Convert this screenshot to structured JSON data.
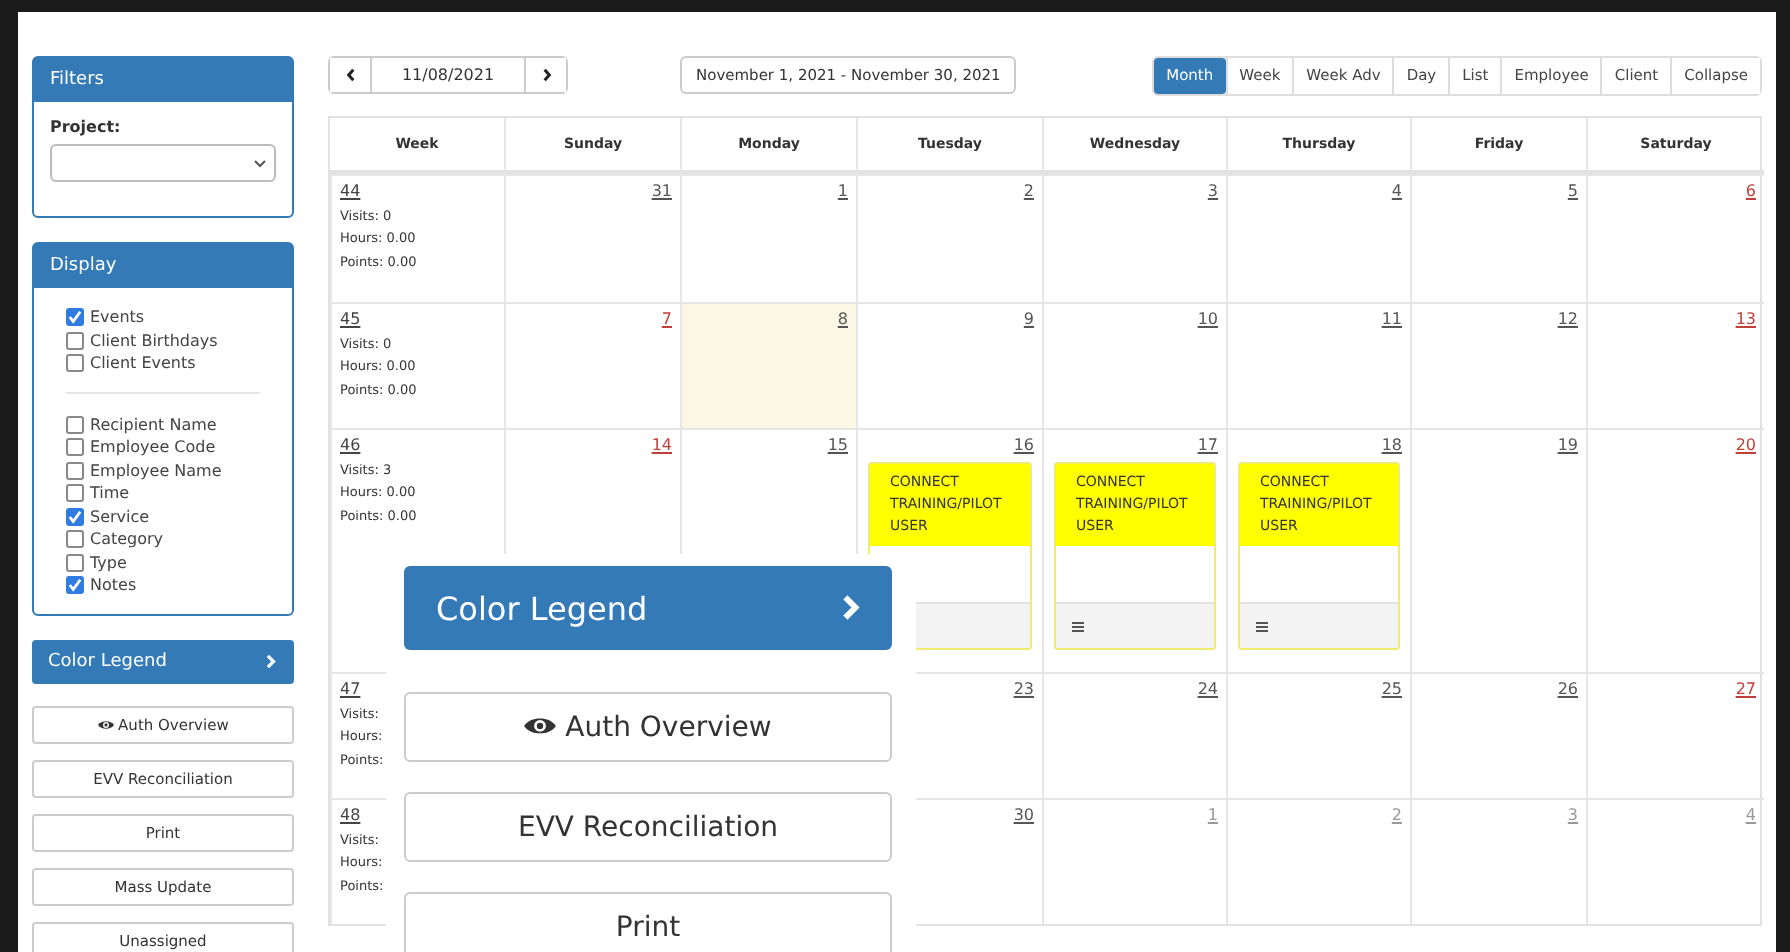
{
  "filters": {
    "title": "Filters",
    "project_label": "Project:"
  },
  "display": {
    "title": "Display",
    "groups": [
      [
        {
          "label": "Events",
          "checked": true
        },
        {
          "label": "Client Birthdays",
          "checked": false
        },
        {
          "label": "Client Events",
          "checked": false
        }
      ],
      [
        {
          "label": "Recipient Name",
          "checked": false
        },
        {
          "label": "Employee Code",
          "checked": false
        },
        {
          "label": "Employee Name",
          "checked": false
        },
        {
          "label": "Time",
          "checked": false
        },
        {
          "label": "Service",
          "checked": true
        },
        {
          "label": "Category",
          "checked": false
        },
        {
          "label": "Type",
          "checked": false
        },
        {
          "label": "Notes",
          "checked": true
        }
      ]
    ]
  },
  "color_legend": {
    "label": "Color Legend"
  },
  "sidebar_buttons": [
    {
      "label": "Auth Overview",
      "kind": "eye"
    },
    {
      "label": "EVV Reconciliation",
      "kind": "plain"
    },
    {
      "label": "Print",
      "kind": "plain"
    },
    {
      "label": "Mass Update",
      "kind": "plain"
    },
    {
      "label": "Unassigned",
      "kind": "plain"
    }
  ],
  "toolbar": {
    "date": "11/08/2021",
    "range": "November 1, 2021 - November 30, 2021",
    "views": [
      {
        "label": "Month",
        "selected": true
      },
      {
        "label": "Week",
        "selected": false
      },
      {
        "label": "Week Adv",
        "selected": false
      },
      {
        "label": "Day",
        "selected": false
      },
      {
        "label": "List",
        "selected": false
      },
      {
        "label": "Employee",
        "selected": false
      },
      {
        "label": "Client",
        "selected": false
      },
      {
        "label": "Collapse",
        "selected": false
      }
    ]
  },
  "calendar": {
    "columns": [
      "Week",
      "Sunday",
      "Monday",
      "Tuesday",
      "Wednesday",
      "Thursday",
      "Friday",
      "Saturday"
    ],
    "weeks": [
      {
        "number": "44",
        "stats": [
          "Visits: 0",
          "Hours: 0.00",
          "Points: 0.00"
        ],
        "days": [
          {
            "number": "31",
            "kind": "weekday",
            "today": false
          },
          {
            "number": "1",
            "kind": "weekday",
            "today": false
          },
          {
            "number": "2",
            "kind": "weekday",
            "today": false
          },
          {
            "number": "3",
            "kind": "weekday",
            "today": false
          },
          {
            "number": "4",
            "kind": "weekday",
            "today": false
          },
          {
            "number": "5",
            "kind": "weekday",
            "today": false
          },
          {
            "number": "6",
            "kind": "weekend",
            "today": false
          }
        ]
      },
      {
        "number": "45",
        "stats": [
          "Visits: 0",
          "Hours: 0.00",
          "Points: 0.00"
        ],
        "days": [
          {
            "number": "7",
            "kind": "weekend",
            "today": false
          },
          {
            "number": "8",
            "kind": "weekday",
            "today": true
          },
          {
            "number": "9",
            "kind": "weekday",
            "today": false
          },
          {
            "number": "10",
            "kind": "weekday",
            "today": false
          },
          {
            "number": "11",
            "kind": "weekday",
            "today": false
          },
          {
            "number": "12",
            "kind": "weekday",
            "today": false
          },
          {
            "number": "13",
            "kind": "weekend",
            "today": false
          }
        ]
      },
      {
        "number": "46",
        "stats": [
          "Visits: 3",
          "Hours: 0.00",
          "Points: 0.00"
        ],
        "days": [
          {
            "number": "14",
            "kind": "weekend",
            "today": false
          },
          {
            "number": "15",
            "kind": "weekday",
            "today": false
          },
          {
            "number": "16",
            "kind": "weekday",
            "today": false,
            "events": [
              {
                "title": "CONNECT TRAINING/PILOT USER"
              }
            ]
          },
          {
            "number": "17",
            "kind": "weekday",
            "today": false,
            "events": [
              {
                "title": "CONNECT TRAINING/PILOT USER"
              }
            ]
          },
          {
            "number": "18",
            "kind": "weekday",
            "today": false,
            "events": [
              {
                "title": "CONNECT TRAINING/PILOT USER"
              }
            ]
          },
          {
            "number": "19",
            "kind": "weekday",
            "today": false
          },
          {
            "number": "20",
            "kind": "weekend",
            "today": false
          }
        ]
      },
      {
        "number": "47",
        "stats": [
          "Visits:",
          "Hours:",
          "Points:"
        ],
        "days": [
          {
            "kind": "hidden"
          },
          {
            "kind": "hidden"
          },
          {
            "number": "23",
            "kind": "weekday",
            "today": false
          },
          {
            "number": "24",
            "kind": "weekday",
            "today": false
          },
          {
            "number": "25",
            "kind": "weekday",
            "today": false
          },
          {
            "number": "26",
            "kind": "weekday",
            "today": false
          },
          {
            "number": "27",
            "kind": "weekend",
            "today": false
          }
        ]
      },
      {
        "number": "48",
        "stats": [
          "Visits:",
          "Hours:",
          "Points:"
        ],
        "days": [
          {
            "kind": "hidden"
          },
          {
            "kind": "hidden"
          },
          {
            "number": "30",
            "kind": "weekday",
            "today": false
          },
          {
            "number": "1",
            "kind": "other_month",
            "today": false
          },
          {
            "number": "2",
            "kind": "other_month",
            "today": false
          },
          {
            "number": "3",
            "kind": "other_month",
            "today": false
          },
          {
            "number": "4",
            "kind": "other_month",
            "today": false
          }
        ]
      }
    ]
  },
  "zoom_view": {
    "color_legend": "Color Legend",
    "buttons": [
      {
        "label": "Auth Overview",
        "kind": "eye"
      },
      {
        "label": "EVV Reconciliation",
        "kind": "plain"
      },
      {
        "label": "Print",
        "kind": "plain"
      }
    ]
  }
}
